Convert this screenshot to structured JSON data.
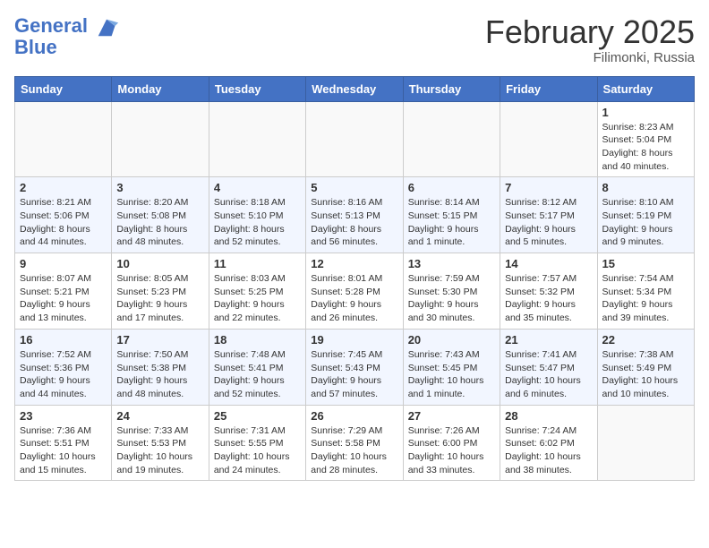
{
  "header": {
    "logo_line1": "General",
    "logo_line2": "Blue",
    "month": "February 2025",
    "location": "Filimonki, Russia"
  },
  "weekdays": [
    "Sunday",
    "Monday",
    "Tuesday",
    "Wednesday",
    "Thursday",
    "Friday",
    "Saturday"
  ],
  "weeks": [
    [
      {
        "day": "",
        "info": ""
      },
      {
        "day": "",
        "info": ""
      },
      {
        "day": "",
        "info": ""
      },
      {
        "day": "",
        "info": ""
      },
      {
        "day": "",
        "info": ""
      },
      {
        "day": "",
        "info": ""
      },
      {
        "day": "1",
        "info": "Sunrise: 8:23 AM\nSunset: 5:04 PM\nDaylight: 8 hours and 40 minutes."
      }
    ],
    [
      {
        "day": "2",
        "info": "Sunrise: 8:21 AM\nSunset: 5:06 PM\nDaylight: 8 hours and 44 minutes."
      },
      {
        "day": "3",
        "info": "Sunrise: 8:20 AM\nSunset: 5:08 PM\nDaylight: 8 hours and 48 minutes."
      },
      {
        "day": "4",
        "info": "Sunrise: 8:18 AM\nSunset: 5:10 PM\nDaylight: 8 hours and 52 minutes."
      },
      {
        "day": "5",
        "info": "Sunrise: 8:16 AM\nSunset: 5:13 PM\nDaylight: 8 hours and 56 minutes."
      },
      {
        "day": "6",
        "info": "Sunrise: 8:14 AM\nSunset: 5:15 PM\nDaylight: 9 hours and 1 minute."
      },
      {
        "day": "7",
        "info": "Sunrise: 8:12 AM\nSunset: 5:17 PM\nDaylight: 9 hours and 5 minutes."
      },
      {
        "day": "8",
        "info": "Sunrise: 8:10 AM\nSunset: 5:19 PM\nDaylight: 9 hours and 9 minutes."
      }
    ],
    [
      {
        "day": "9",
        "info": "Sunrise: 8:07 AM\nSunset: 5:21 PM\nDaylight: 9 hours and 13 minutes."
      },
      {
        "day": "10",
        "info": "Sunrise: 8:05 AM\nSunset: 5:23 PM\nDaylight: 9 hours and 17 minutes."
      },
      {
        "day": "11",
        "info": "Sunrise: 8:03 AM\nSunset: 5:25 PM\nDaylight: 9 hours and 22 minutes."
      },
      {
        "day": "12",
        "info": "Sunrise: 8:01 AM\nSunset: 5:28 PM\nDaylight: 9 hours and 26 minutes."
      },
      {
        "day": "13",
        "info": "Sunrise: 7:59 AM\nSunset: 5:30 PM\nDaylight: 9 hours and 30 minutes."
      },
      {
        "day": "14",
        "info": "Sunrise: 7:57 AM\nSunset: 5:32 PM\nDaylight: 9 hours and 35 minutes."
      },
      {
        "day": "15",
        "info": "Sunrise: 7:54 AM\nSunset: 5:34 PM\nDaylight: 9 hours and 39 minutes."
      }
    ],
    [
      {
        "day": "16",
        "info": "Sunrise: 7:52 AM\nSunset: 5:36 PM\nDaylight: 9 hours and 44 minutes."
      },
      {
        "day": "17",
        "info": "Sunrise: 7:50 AM\nSunset: 5:38 PM\nDaylight: 9 hours and 48 minutes."
      },
      {
        "day": "18",
        "info": "Sunrise: 7:48 AM\nSunset: 5:41 PM\nDaylight: 9 hours and 52 minutes."
      },
      {
        "day": "19",
        "info": "Sunrise: 7:45 AM\nSunset: 5:43 PM\nDaylight: 9 hours and 57 minutes."
      },
      {
        "day": "20",
        "info": "Sunrise: 7:43 AM\nSunset: 5:45 PM\nDaylight: 10 hours and 1 minute."
      },
      {
        "day": "21",
        "info": "Sunrise: 7:41 AM\nSunset: 5:47 PM\nDaylight: 10 hours and 6 minutes."
      },
      {
        "day": "22",
        "info": "Sunrise: 7:38 AM\nSunset: 5:49 PM\nDaylight: 10 hours and 10 minutes."
      }
    ],
    [
      {
        "day": "23",
        "info": "Sunrise: 7:36 AM\nSunset: 5:51 PM\nDaylight: 10 hours and 15 minutes."
      },
      {
        "day": "24",
        "info": "Sunrise: 7:33 AM\nSunset: 5:53 PM\nDaylight: 10 hours and 19 minutes."
      },
      {
        "day": "25",
        "info": "Sunrise: 7:31 AM\nSunset: 5:55 PM\nDaylight: 10 hours and 24 minutes."
      },
      {
        "day": "26",
        "info": "Sunrise: 7:29 AM\nSunset: 5:58 PM\nDaylight: 10 hours and 28 minutes."
      },
      {
        "day": "27",
        "info": "Sunrise: 7:26 AM\nSunset: 6:00 PM\nDaylight: 10 hours and 33 minutes."
      },
      {
        "day": "28",
        "info": "Sunrise: 7:24 AM\nSunset: 6:02 PM\nDaylight: 10 hours and 38 minutes."
      },
      {
        "day": "",
        "info": ""
      }
    ]
  ]
}
